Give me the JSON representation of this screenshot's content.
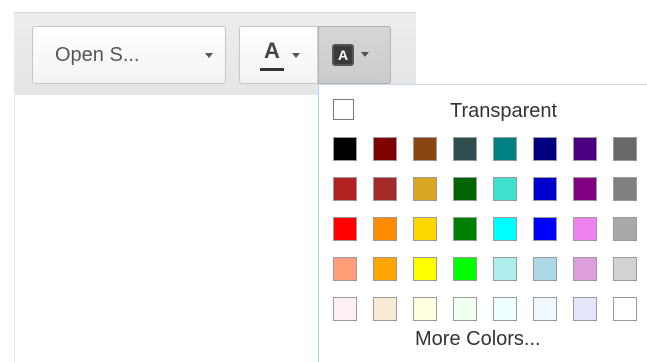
{
  "toolbar": {
    "font_select": {
      "value": "Open S...",
      "icon": "chevron-down-icon"
    },
    "text_color": {
      "glyph": "A",
      "icon": "font-color-icon"
    },
    "background_color": {
      "glyph": "A",
      "icon": "background-color-icon",
      "active": true
    }
  },
  "color_panel": {
    "transparent_label": "Transparent",
    "more_colors_label": "More Colors...",
    "swatches": [
      "#000000",
      "#7f0000",
      "#8b4513",
      "#2f4f4f",
      "#008080",
      "#000080",
      "#4b0082",
      "#696969",
      "#b22222",
      "#a52a2a",
      "#daa520",
      "#006400",
      "#40e0d0",
      "#0000cd",
      "#800080",
      "#808080",
      "#ff0000",
      "#ff8c00",
      "#ffd700",
      "#008000",
      "#00ffff",
      "#0000ff",
      "#ee82ee",
      "#a9a9a9",
      "#ffa07a",
      "#ffa500",
      "#ffff00",
      "#00ff00",
      "#afeeee",
      "#add8e6",
      "#dda0dd",
      "#d3d3d3",
      "#fff0f5",
      "#faebd7",
      "#ffffe0",
      "#f0fff0",
      "#f0ffff",
      "#f0f8ff",
      "#e6e6fa",
      "#ffffff"
    ]
  }
}
